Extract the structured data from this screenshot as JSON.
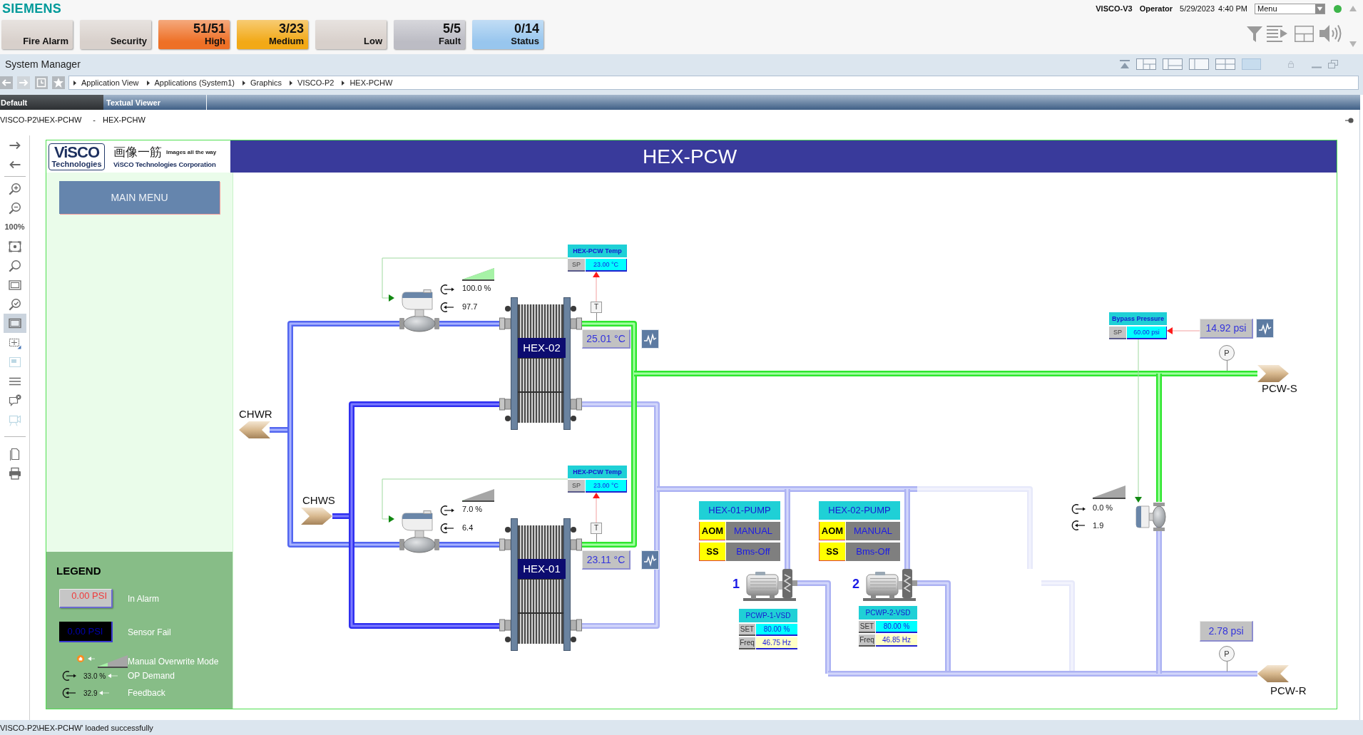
{
  "brand": "SIEMENS",
  "session": {
    "station": "VISCO-V3",
    "user": "Operator",
    "date": "5/29/2023",
    "time": "4:40 PM",
    "menu": "Menu",
    "connected": true
  },
  "alarm_summary": [
    {
      "label": "Fire Alarm",
      "color": "#d8d0cb"
    },
    {
      "label": "Security",
      "color": "#d8d0cb"
    },
    {
      "count": "51/51",
      "label": "High",
      "color": "#ee7026"
    },
    {
      "count": "3/23",
      "label": "Medium",
      "color": "#f2a916"
    },
    {
      "label": "Low",
      "color": "#d8d0cb"
    },
    {
      "count": "5/5",
      "label": "Fault",
      "color": "#bcbcc4"
    },
    {
      "count": "0/14",
      "label": "Status",
      "color": "#98c6ee"
    }
  ],
  "app_title": "System Manager",
  "breadcrumb": [
    "Application View",
    "Applications (System1)",
    "Graphics",
    "VISCO-P2",
    "HEX-PCHW"
  ],
  "tabs": [
    {
      "label": "Default",
      "selected": true
    },
    {
      "label": "Textual Viewer",
      "selected": false
    }
  ],
  "document": {
    "path": "VISCO-P2\\HEX-PCHW",
    "separator": "-",
    "name": "HEX-PCHW"
  },
  "view_toolbar": {
    "zoom_level": "100%",
    "tools": [
      {
        "selected": false,
        "disabled": false
      },
      {
        "selected": false,
        "disabled": false
      },
      {
        "selected": false,
        "disabled": false
      },
      {
        "selected": false,
        "disabled": false
      },
      {
        "selected": false,
        "disabled": false
      },
      {
        "selected": false,
        "disabled": false
      },
      {
        "selected": false,
        "disabled": false
      },
      {
        "selected": false,
        "disabled": false
      },
      {
        "selected": true,
        "disabled": false
      },
      {
        "selected": false,
        "disabled": false
      },
      {
        "selected": false,
        "disabled": true
      },
      {
        "selected": false,
        "disabled": false
      },
      {
        "selected": false,
        "disabled": false
      },
      {
        "selected": false,
        "disabled": true
      },
      {
        "selected": false,
        "disabled": false
      },
      {
        "selected": false,
        "disabled": false
      }
    ]
  },
  "graphic": {
    "logo": {
      "mark": "ViSCO",
      "mark_sub": "Technologies",
      "motto_jp": "画像一筋",
      "motto": "Images all the way",
      "company": "ViSCO Technologies Corporation"
    },
    "title": "HEX-PCW",
    "main_menu": "MAIN MENU",
    "legend": {
      "title": "LEGEND",
      "items": [
        {
          "kind": "alarm",
          "sample": "0.00 PSI",
          "label": "In Alarm"
        },
        {
          "kind": "sensor_fail",
          "sample": "0.00 PSI",
          "label": "Sensor Fail"
        },
        {
          "kind": "manual",
          "level": 0.33,
          "label": "Manual Overwrite Mode"
        },
        {
          "kind": "demand",
          "sample": "33.0 %",
          "label": "OP Demand"
        },
        {
          "kind": "feedback",
          "sample": "32.9",
          "label": "Feedback"
        }
      ]
    },
    "ports": [
      {
        "label": "CHWR"
      },
      {
        "label": "CHWS"
      },
      {
        "label": "PCW-S"
      },
      {
        "label": "PCW-R"
      }
    ],
    "exchangers": [
      {
        "name": "HEX-02",
        "setpoint_title": "HEX-PCW Temp",
        "sp_label": "SP",
        "setpoint": "23.00 °C",
        "sensor": "T",
        "temperature": "25.01 °C",
        "valve": {
          "level": 1.0,
          "demand": "100.0 %",
          "feedback": "97.7"
        }
      },
      {
        "name": "HEX-01",
        "setpoint_title": "HEX-PCW Temp",
        "sp_label": "SP",
        "setpoint": "23.00 °C",
        "sensor": "T",
        "temperature": "23.11 °C",
        "valve": {
          "level": 0.07,
          "demand": "7.0 %",
          "feedback": "6.4"
        }
      }
    ],
    "bypass": {
      "title": "Bypass Pressure",
      "sp_label": "SP",
      "setpoint": "60.00 psi",
      "pressure": "14.92 psi",
      "sensor": "P",
      "valve": {
        "level": 0.0,
        "demand": "0.0 %",
        "feedback": "1.9"
      }
    },
    "return_pressure": {
      "value": "2.78 psi",
      "sensor": "P"
    },
    "pumps": [
      {
        "title": "HEX-01-PUMP",
        "number": "1",
        "mode_label": "AOM",
        "mode": "MANUAL",
        "status_label": "SS",
        "status": "Bms-Off",
        "vsd": {
          "title": "PCWP-1-VSD",
          "set_label": "SET",
          "set": "80.00 %",
          "freq_label": "Freq",
          "freq": "46.75 Hz"
        }
      },
      {
        "title": "HEX-02-PUMP",
        "number": "2",
        "mode_label": "AOM",
        "mode": "MANUAL",
        "status_label": "SS",
        "status": "Bms-Off",
        "vsd": {
          "title": "PCWP-2-VSD",
          "set_label": "SET",
          "set": "80.00 %",
          "freq_label": "Freq",
          "freq": "46.85 Hz"
        }
      }
    ]
  },
  "status_bar": "VISCO-P2\\HEX-PCHW' loaded successfully"
}
